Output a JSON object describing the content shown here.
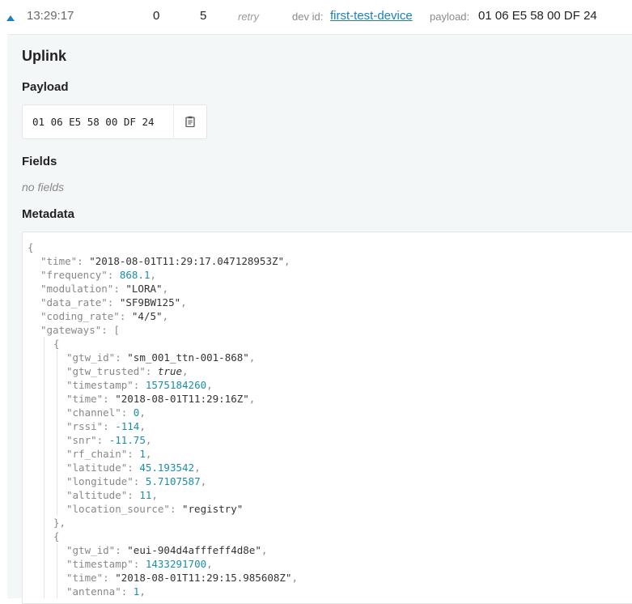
{
  "header": {
    "time": "13:29:17",
    "counter": "0",
    "port": "5",
    "retry_label": "retry",
    "dev_id_label": "dev id:",
    "dev_id": "first-test-device",
    "payload_label": "payload:",
    "payload": "01 06 E5 58 00 DF 24"
  },
  "detail": {
    "title": "Uplink",
    "payload_heading": "Payload",
    "payload_hex": "01 06 E5 58 00 DF 24",
    "fields_heading": "Fields",
    "no_fields": "no fields",
    "metadata_heading": "Metadata"
  },
  "metadata_lines": [
    {
      "indent": 0,
      "parts": [
        [
          "p",
          "{"
        ]
      ]
    },
    {
      "indent": 1,
      "parts": [
        [
          "p",
          "\"time\""
        ],
        [
          "p",
          ": "
        ],
        [
          "s",
          "\"2018-08-01T11:29:17.047128953Z\""
        ],
        [
          "p",
          ","
        ]
      ]
    },
    {
      "indent": 1,
      "parts": [
        [
          "p",
          "\"frequency\""
        ],
        [
          "p",
          ": "
        ],
        [
          "n",
          "868.1"
        ],
        [
          "p",
          ","
        ]
      ]
    },
    {
      "indent": 1,
      "parts": [
        [
          "p",
          "\"modulation\""
        ],
        [
          "p",
          ": "
        ],
        [
          "s",
          "\"LORA\""
        ],
        [
          "p",
          ","
        ]
      ]
    },
    {
      "indent": 1,
      "parts": [
        [
          "p",
          "\"data_rate\""
        ],
        [
          "p",
          ": "
        ],
        [
          "s",
          "\"SF9BW125\""
        ],
        [
          "p",
          ","
        ]
      ]
    },
    {
      "indent": 1,
      "parts": [
        [
          "p",
          "\"coding_rate\""
        ],
        [
          "p",
          ": "
        ],
        [
          "s",
          "\"4/5\""
        ],
        [
          "p",
          ","
        ]
      ]
    },
    {
      "indent": 1,
      "parts": [
        [
          "p",
          "\"gateways\""
        ],
        [
          "p",
          ": ["
        ]
      ]
    },
    {
      "indent": 2,
      "parts": [
        [
          "p",
          "{"
        ]
      ]
    },
    {
      "indent": 3,
      "parts": [
        [
          "p",
          "\"gtw_id\""
        ],
        [
          "p",
          ": "
        ],
        [
          "s",
          "\"sm_001_ttn-001-868\""
        ],
        [
          "p",
          ","
        ]
      ]
    },
    {
      "indent": 3,
      "parts": [
        [
          "p",
          "\"gtw_trusted\""
        ],
        [
          "p",
          ": "
        ],
        [
          "b",
          "true"
        ],
        [
          "p",
          ","
        ]
      ]
    },
    {
      "indent": 3,
      "parts": [
        [
          "p",
          "\"timestamp\""
        ],
        [
          "p",
          ": "
        ],
        [
          "n",
          "1575184260"
        ],
        [
          "p",
          ","
        ]
      ]
    },
    {
      "indent": 3,
      "parts": [
        [
          "p",
          "\"time\""
        ],
        [
          "p",
          ": "
        ],
        [
          "s",
          "\"2018-08-01T11:29:16Z\""
        ],
        [
          "p",
          ","
        ]
      ]
    },
    {
      "indent": 3,
      "parts": [
        [
          "p",
          "\"channel\""
        ],
        [
          "p",
          ": "
        ],
        [
          "n",
          "0"
        ],
        [
          "p",
          ","
        ]
      ]
    },
    {
      "indent": 3,
      "parts": [
        [
          "p",
          "\"rssi\""
        ],
        [
          "p",
          ": "
        ],
        [
          "n",
          "-114"
        ],
        [
          "p",
          ","
        ]
      ]
    },
    {
      "indent": 3,
      "parts": [
        [
          "p",
          "\"snr\""
        ],
        [
          "p",
          ": "
        ],
        [
          "n",
          "-11.75"
        ],
        [
          "p",
          ","
        ]
      ]
    },
    {
      "indent": 3,
      "parts": [
        [
          "p",
          "\"rf_chain\""
        ],
        [
          "p",
          ": "
        ],
        [
          "n",
          "1"
        ],
        [
          "p",
          ","
        ]
      ]
    },
    {
      "indent": 3,
      "parts": [
        [
          "p",
          "\"latitude\""
        ],
        [
          "p",
          ": "
        ],
        [
          "n",
          "45.193542"
        ],
        [
          "p",
          ","
        ]
      ]
    },
    {
      "indent": 3,
      "parts": [
        [
          "p",
          "\"longitude\""
        ],
        [
          "p",
          ": "
        ],
        [
          "n",
          "5.7107587"
        ],
        [
          "p",
          ","
        ]
      ]
    },
    {
      "indent": 3,
      "parts": [
        [
          "p",
          "\"altitude\""
        ],
        [
          "p",
          ": "
        ],
        [
          "n",
          "11"
        ],
        [
          "p",
          ","
        ]
      ]
    },
    {
      "indent": 3,
      "parts": [
        [
          "p",
          "\"location_source\""
        ],
        [
          "p",
          ": "
        ],
        [
          "s",
          "\"registry\""
        ]
      ]
    },
    {
      "indent": 2,
      "parts": [
        [
          "p",
          "},"
        ]
      ]
    },
    {
      "indent": 2,
      "parts": [
        [
          "p",
          "{"
        ]
      ]
    },
    {
      "indent": 3,
      "parts": [
        [
          "p",
          "\"gtw_id\""
        ],
        [
          "p",
          ": "
        ],
        [
          "s",
          "\"eui-904d4afffeff4d8e\""
        ],
        [
          "p",
          ","
        ]
      ]
    },
    {
      "indent": 3,
      "parts": [
        [
          "p",
          "\"timestamp\""
        ],
        [
          "p",
          ": "
        ],
        [
          "n",
          "1433291700"
        ],
        [
          "p",
          ","
        ]
      ]
    },
    {
      "indent": 3,
      "parts": [
        [
          "p",
          "\"time\""
        ],
        [
          "p",
          ": "
        ],
        [
          "s",
          "\"2018-08-01T11:29:15.985608Z\""
        ],
        [
          "p",
          ","
        ]
      ]
    },
    {
      "indent": 3,
      "parts": [
        [
          "p",
          "\"antenna\""
        ],
        [
          "p",
          ": "
        ],
        [
          "n",
          "1"
        ],
        [
          "p",
          ","
        ]
      ]
    }
  ],
  "colors": {
    "link": "#1e7fbd",
    "toggle": "#1e7fbd",
    "number": "#1a8fa8",
    "panel_bg": "#f4f7f8"
  },
  "icons": {
    "toggle": "triangle-up-icon",
    "copy": "clipboard-icon"
  }
}
